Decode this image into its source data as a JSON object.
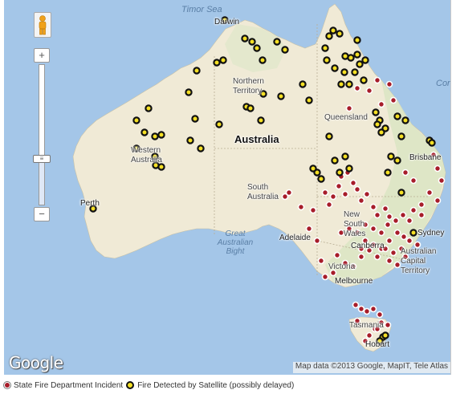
{
  "labels": {
    "sea": "Timor Sea",
    "coral": "Cora",
    "bight": "Great Australian Bight",
    "country": "Australia",
    "territories": {
      "nt": "Northern Territory",
      "wa": "Western Australia",
      "qld": "Queensland",
      "sa": "South Australia",
      "nsw": "New South Wales",
      "act": "Australian Capital Territory",
      "vic": "Victoria",
      "tas": "Tasmania"
    },
    "cities": {
      "darwin": "Darwin",
      "perth": "Perth",
      "adelaide": "Adelaide",
      "melbourne": "Melbourne",
      "sydney": "Sydney",
      "brisbane": "Brisbane",
      "hobart": "Hobart",
      "canberra": "Canberra"
    }
  },
  "controls": {
    "zoom_in": "+",
    "zoom_out": "−",
    "zoom_level": 0.33
  },
  "logo": "Google",
  "attribution": "Map data ©2013 Google, MapIT, Tele Atlas",
  "legend": {
    "incident": "State Fire Department Incident",
    "satellite": "Fire Detected by Satellite (possibly delayed)"
  },
  "colors": {
    "water": "#a4c6e8",
    "land": "#f2ecd8",
    "incident_marker": "#a71d2a",
    "satellite_marker": "#f5e025"
  },
  "markers": {
    "satellite": [
      [
        275,
        25
      ],
      [
        300,
        48
      ],
      [
        309,
        52
      ],
      [
        315,
        60
      ],
      [
        322,
        75
      ],
      [
        340,
        52
      ],
      [
        350,
        62
      ],
      [
        240,
        88
      ],
      [
        265,
        78
      ],
      [
        273,
        75
      ],
      [
        230,
        115
      ],
      [
        180,
        135
      ],
      [
        165,
        150
      ],
      [
        175,
        165
      ],
      [
        188,
        170
      ],
      [
        196,
        168
      ],
      [
        232,
        175
      ],
      [
        245,
        185
      ],
      [
        238,
        148
      ],
      [
        268,
        155
      ],
      [
        302,
        133
      ],
      [
        307,
        135
      ],
      [
        320,
        150
      ],
      [
        345,
        120
      ],
      [
        372,
        105
      ],
      [
        380,
        125
      ],
      [
        323,
        117
      ],
      [
        165,
        185
      ],
      [
        188,
        195
      ],
      [
        189,
        206
      ],
      [
        196,
        208
      ],
      [
        111,
        260
      ],
      [
        405,
        45
      ],
      [
        410,
        38
      ],
      [
        418,
        42
      ],
      [
        440,
        50
      ],
      [
        400,
        60
      ],
      [
        425,
        70
      ],
      [
        432,
        72
      ],
      [
        440,
        68
      ],
      [
        450,
        75
      ],
      [
        402,
        75
      ],
      [
        412,
        85
      ],
      [
        424,
        90
      ],
      [
        443,
        80
      ],
      [
        437,
        90
      ],
      [
        430,
        105
      ],
      [
        420,
        105
      ],
      [
        448,
        100
      ],
      [
        463,
        140
      ],
      [
        468,
        150
      ],
      [
        475,
        160
      ],
      [
        470,
        165
      ],
      [
        465,
        155
      ],
      [
        490,
        145
      ],
      [
        500,
        150
      ],
      [
        495,
        170
      ],
      [
        530,
        175
      ],
      [
        533,
        178
      ],
      [
        405,
        170
      ],
      [
        412,
        200
      ],
      [
        418,
        215
      ],
      [
        425,
        195
      ],
      [
        430,
        210
      ],
      [
        390,
        215
      ],
      [
        395,
        223
      ],
      [
        385,
        210
      ],
      [
        482,
        195
      ],
      [
        490,
        200
      ],
      [
        478,
        215
      ],
      [
        495,
        240
      ],
      [
        510,
        290
      ],
      [
        472,
        420
      ],
      [
        468,
        425
      ],
      [
        475,
        418
      ]
    ],
    "incident": [
      [
        480,
        105
      ],
      [
        465,
        100
      ],
      [
        455,
        113
      ],
      [
        440,
        110
      ],
      [
        430,
        135
      ],
      [
        485,
        125
      ],
      [
        470,
        130
      ],
      [
        535,
        193
      ],
      [
        540,
        210
      ],
      [
        545,
        225
      ],
      [
        530,
        240
      ],
      [
        540,
        250
      ],
      [
        520,
        255
      ],
      [
        500,
        215
      ],
      [
        510,
        225
      ],
      [
        400,
        240
      ],
      [
        405,
        255
      ],
      [
        410,
        245
      ],
      [
        417,
        232
      ],
      [
        420,
        220
      ],
      [
        428,
        215
      ],
      [
        435,
        228
      ],
      [
        425,
        242
      ],
      [
        440,
        236
      ],
      [
        445,
        250
      ],
      [
        452,
        242
      ],
      [
        460,
        258
      ],
      [
        465,
        268
      ],
      [
        475,
        260
      ],
      [
        480,
        270
      ],
      [
        488,
        275
      ],
      [
        497,
        268
      ],
      [
        505,
        275
      ],
      [
        510,
        262
      ],
      [
        520,
        268
      ],
      [
        490,
        290
      ],
      [
        498,
        295
      ],
      [
        505,
        300
      ],
      [
        515,
        305
      ],
      [
        480,
        300
      ],
      [
        470,
        310
      ],
      [
        460,
        305
      ],
      [
        450,
        300
      ],
      [
        445,
        310
      ],
      [
        440,
        290
      ],
      [
        430,
        285
      ],
      [
        420,
        290
      ],
      [
        450,
        280
      ],
      [
        460,
        285
      ],
      [
        470,
        290
      ],
      [
        478,
        280
      ],
      [
        385,
        262
      ],
      [
        370,
        258
      ],
      [
        355,
        240
      ],
      [
        350,
        245
      ],
      [
        380,
        285
      ],
      [
        390,
        300
      ],
      [
        395,
        325
      ],
      [
        400,
        345
      ],
      [
        410,
        340
      ],
      [
        415,
        318
      ],
      [
        425,
        328
      ],
      [
        435,
        332
      ],
      [
        445,
        320
      ],
      [
        455,
        312
      ],
      [
        465,
        320
      ],
      [
        475,
        310
      ],
      [
        485,
        315
      ],
      [
        495,
        310
      ],
      [
        500,
        320
      ],
      [
        490,
        330
      ],
      [
        480,
        325
      ],
      [
        438,
        380
      ],
      [
        445,
        385
      ],
      [
        452,
        388
      ],
      [
        460,
        385
      ],
      [
        468,
        392
      ],
      [
        470,
        402
      ],
      [
        462,
        410
      ],
      [
        455,
        418
      ],
      [
        450,
        425
      ],
      [
        465,
        410
      ],
      [
        478,
        405
      ],
      [
        440,
        400
      ]
    ]
  }
}
